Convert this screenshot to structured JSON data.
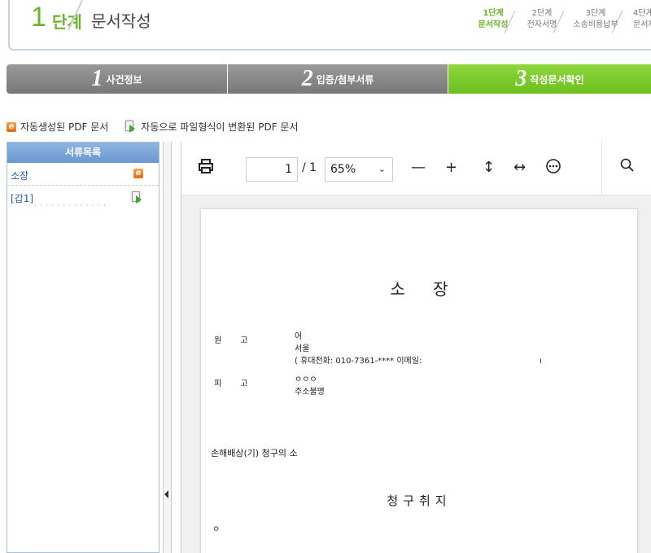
{
  "stage": {
    "number": "1",
    "word": "단계",
    "title": "문서작성",
    "steps": [
      {
        "top": "1단계",
        "bottom": "문서작성",
        "active": true
      },
      {
        "top": "2단계",
        "bottom": "전자서명",
        "active": false
      },
      {
        "top": "3단계",
        "bottom": "소송비용납부",
        "active": false
      },
      {
        "top": "4단계",
        "bottom": "문서제",
        "active": false
      }
    ]
  },
  "tabs": [
    {
      "num": "1",
      "label": "사건정보"
    },
    {
      "num": "2",
      "label": "입증/첨부서류"
    },
    {
      "num": "3",
      "label": "작성문서확인"
    }
  ],
  "colors": {
    "accent_green": "#6ab52b",
    "tab_gray": "#8a8a8a",
    "tab_active": "#7ccb2b",
    "link_blue": "#1b5fae"
  },
  "legend": {
    "auto_pdf": "자동생성된 PDF 문서",
    "converted_pdf": "자동으로 파일형식이 변환된 PDF 문서"
  },
  "doc_list": {
    "header": "서류목록",
    "items": [
      {
        "label": "소장",
        "icon": "e-pdf-icon"
      },
      {
        "label": "[갑1]",
        "icon": "converted-doc-icon"
      }
    ]
  },
  "viewer": {
    "page_current": "1",
    "page_total": "/ 1",
    "zoom": "65%",
    "icons": [
      "print-icon",
      "zoom-out-icon",
      "zoom-in-icon",
      "fit-height-icon",
      "fit-width-icon",
      "more-icon",
      "search-icon"
    ]
  },
  "document": {
    "title_a": "소",
    "title_b": "장",
    "plaintiff_label": "원 고",
    "plaintiff_name": "어",
    "plaintiff_addr": "서울",
    "plaintiff_phone": "( 휴대전화: 010-7361-****   이메일:",
    "defendant_label": "피 고",
    "defendant_name": "ㅇㅇㅇ",
    "defendant_addr": "주소불명",
    "case_name": "손해배상(기) 청구의 소",
    "claim_title": "청구취지",
    "claim_first": "ㅇ"
  }
}
